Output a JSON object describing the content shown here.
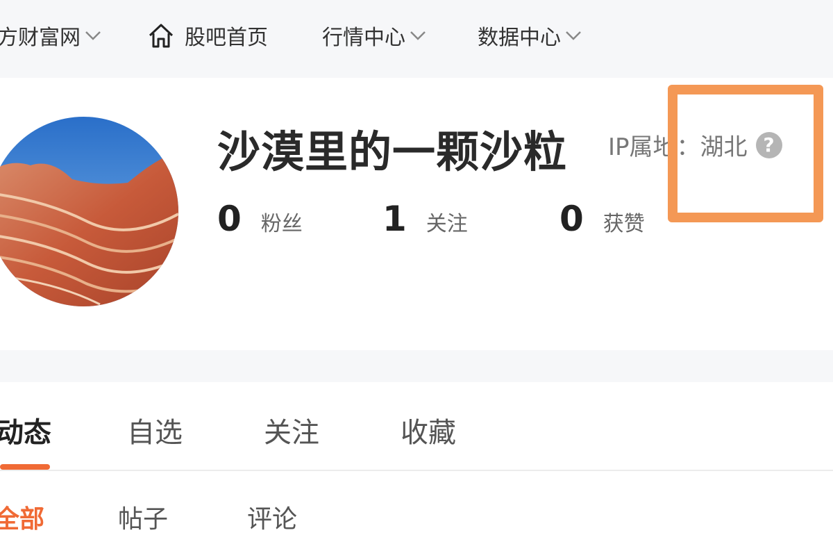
{
  "nav": {
    "site_label": "方财富网",
    "home_label": "股吧首页",
    "market_label": "行情中心",
    "data_label": "数据中心"
  },
  "profile": {
    "username": "沙漠里的一颗沙粒",
    "ip_label": "IP属地：湖北",
    "help_symbol": "?",
    "stats": [
      {
        "value": "0",
        "label": "粉丝"
      },
      {
        "value": "1",
        "label": "关注"
      },
      {
        "value": "0",
        "label": "获赞"
      }
    ]
  },
  "tabs": [
    {
      "label": "动态"
    },
    {
      "label": "自选"
    },
    {
      "label": "关注"
    },
    {
      "label": "收藏"
    }
  ],
  "subtabs": [
    {
      "label": "全部"
    },
    {
      "label": "帖子"
    },
    {
      "label": "评论"
    }
  ],
  "colors": {
    "accent": "#f06a35",
    "highlight": "#f49855",
    "nav_bg": "#f6f7f9"
  },
  "icons": {
    "home": "home-icon",
    "chevron": "chevron-down-icon",
    "help": "help-icon"
  }
}
